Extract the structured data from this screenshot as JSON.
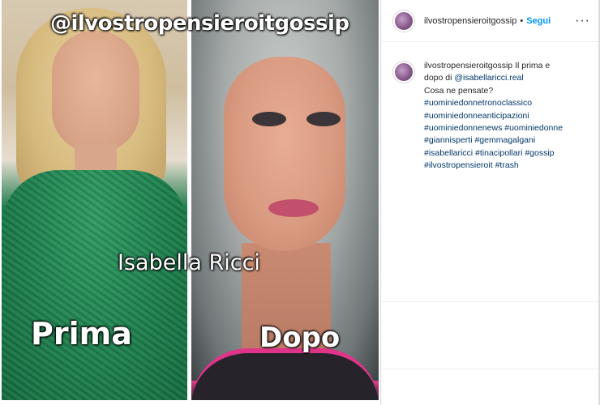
{
  "media": {
    "watermark": "@ilvostropensieroitgossip",
    "name_label": "Isabella Ricci",
    "before_label": "Prima",
    "after_label": "Dopo"
  },
  "header": {
    "username": "ilvostropensieroitgossip",
    "separator": "•",
    "follow_label": "Segui",
    "more_icon": "more-options-icon"
  },
  "caption": {
    "username": "ilvostropensieroitgossip",
    "text_line1": "Il prima e",
    "text_line2_prefix": "dopo di",
    "mention": "@isabellaricci.real",
    "text_line3": "Cosa ne pensate?",
    "hashtags": [
      "#uominiedonnetronoclassico",
      "#uominiedonneanticipazioni",
      "#uominiedonnenews",
      "#uominiedonne",
      "#giannisperti",
      "#gemmagalgani",
      "#isabellaricci",
      "#tinacipollari",
      "#gossip",
      "#ilvostropensieroit",
      "#trash"
    ]
  },
  "colors": {
    "link": "#00376b",
    "follow": "#0095f6",
    "text": "#262626"
  }
}
